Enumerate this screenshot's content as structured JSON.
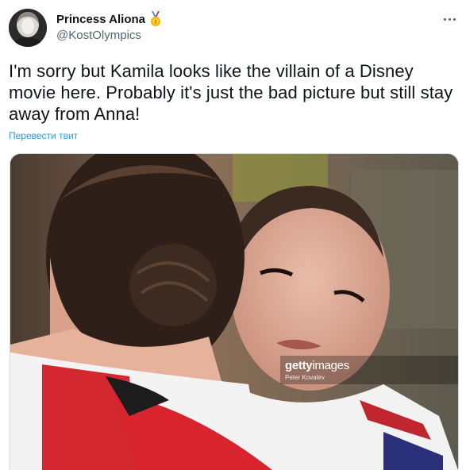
{
  "tweet": {
    "display_name": "Princess Aliona",
    "badge_icon": "gold-medal-icon",
    "handle": "@KostOlympics",
    "text": "I'm sorry but Kamila looks like the villain of a Disney movie here. Probably it's just the bad picture but still stay away from Anna!",
    "translate_label": "Перевести твит",
    "more_icon": "more-dots-icon"
  },
  "photo": {
    "watermark_brand_bold": "getty",
    "watermark_brand_thin": "images",
    "watermark_credit": "Peter Kovalev"
  },
  "colors": {
    "text_primary": "#0f1419",
    "text_secondary": "#536471",
    "link": "#1d9bf0",
    "border": "#cfd9de"
  }
}
